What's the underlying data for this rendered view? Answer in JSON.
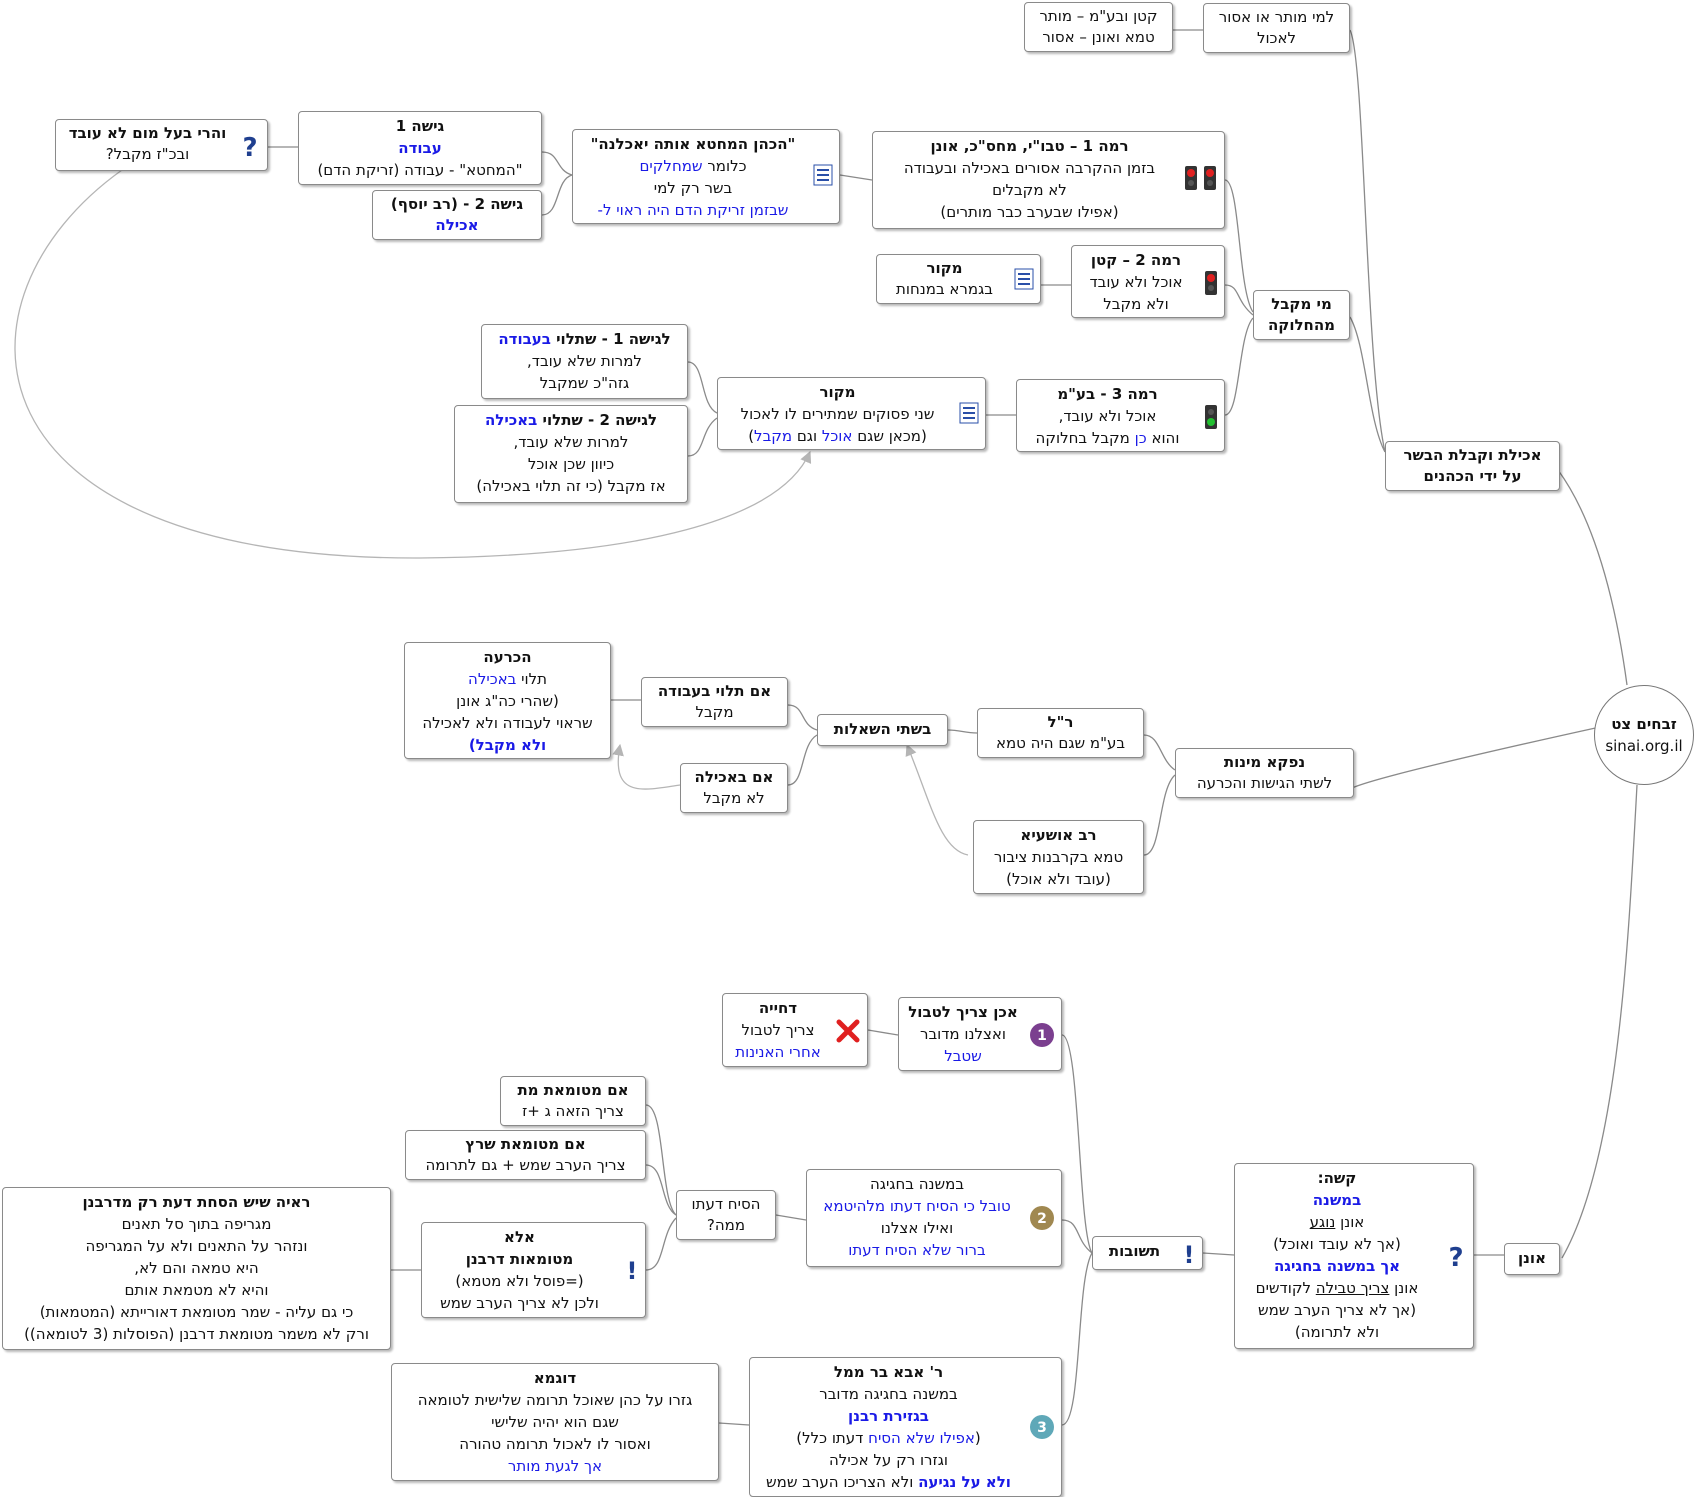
{
  "root": {
    "title": "זבחים צט",
    "site": "sinai.org.il"
  },
  "top": {
    "branch": {
      "line1": "אכילת וקבלת הבשר",
      "line2": "על  ידי הכהנים"
    },
    "who_allowed": {
      "line1": "למי מותר או אסור",
      "line2": "לאכול"
    },
    "katan_onen": {
      "line1": "קטן ובע\"מ – מותר",
      "line2": "טמא ואונן – אסור"
    },
    "mi_mekabel": {
      "line1": "מי מקבל",
      "line2": "מהחלוקה"
    },
    "rama1": {
      "title": "רמה 1 – טבו\"י, מחס\"כ, אונן",
      "line1": "בזמן ההקרבה אסורים באכילה ובעבודה",
      "line2": "לא מקבלים",
      "line3": "(אפילו שבערב כבר מותרים)"
    },
    "hakohen": {
      "title": "\"הכהן המחטא אותה יאכלנה\"",
      "line1a": "כלומר ",
      "line1b": "שמחלקים",
      "line2": "בשר רק למי",
      "line3a": "שבזמן זריקת הדם היה ראוי ל-",
      "line3b": "-"
    },
    "gisha1": {
      "title": "גישה 1",
      "line1": "עבודה",
      "line2": "\"המחטא\" - עבודה (זריקת הדם)"
    },
    "gisha2": {
      "title": "גישה 2  -  (רב יוסף)",
      "line1": "אכילה"
    },
    "baal_mum": {
      "title": "והרי בעל מום לא עובד",
      "line1": "ובכ\"ז מקבל?"
    },
    "rama2": {
      "title": "רמה 2 – קטן",
      "line1": "אוכל ולא עובד",
      "line2": "ולא מקבל"
    },
    "makor_rama2": {
      "title": "מקור",
      "line1": "בגמרא במנחות"
    },
    "rama3": {
      "title": "רמה 3 - בע\"מ",
      "line1": "אוכל ולא עובד,",
      "line2a": "והוא ",
      "line2b": "כן",
      "line2c": " מקבל בחלוקה"
    },
    "makor_rama3": {
      "title": "מקור",
      "line1": "שני פסוקים שמתירים לו לאכול",
      "line2a": "(מכאן שגם ",
      "line2b": "אוכל",
      "line2c": " וגם ",
      "line2d": "מקבל",
      "line2e": ")"
    },
    "lagisha1": {
      "title": "לגישה 1 - שתלוי ",
      "title_blue": "בעבודה",
      "line1": "למרות שלא עובד,",
      "line2": "גזה\"כ שמקבל"
    },
    "lagisha2": {
      "title": "לגישה 2  - שתלוי ",
      "title_blue": "באכילה",
      "line1": "למרות שלא עובד,",
      "line2": "כיוון שכן אוכל",
      "line3": "אז מקבל (כי זה תלוי באכילה)"
    }
  },
  "middle": {
    "nafka": {
      "title": "נפקא מינות",
      "line1": "לשתי הגישות והכרעה"
    },
    "rl": {
      "title": "ר\"ל",
      "line1": "בע\"מ שגם היה טמא"
    },
    "rav_oshaya": {
      "title": "רב אושעיא",
      "line1": "טמא בקרבנות ציבור",
      "line2": "(עובד ולא אוכל)"
    },
    "bishtei": {
      "title": "בשתי השאלות"
    },
    "im_avoda": {
      "title": "אם תלוי בעבודה",
      "line1": "מקבל"
    },
    "im_achila": {
      "title": "אם באכילה",
      "line1": "לא מקבל"
    },
    "hachraa": {
      "title": "הכרעה",
      "line1a": "תלוי ",
      "line1b": "באכילה",
      "line2": "(שהרי כה\"ג אונן",
      "line3": "שראוי לעבודה ולא לאכילה",
      "line4": "ולא מקבל)"
    }
  },
  "bottom": {
    "onen": {
      "title": "אונן"
    },
    "kasha": {
      "title": "קשה:",
      "line1": "במשנה",
      "line2a": "אונן ",
      "line2b": "נוגע",
      "line3": "(אך לא עובד ואוכל)",
      "line4": "אך במשנה בחגיגה",
      "line5a": "אונן ",
      "line5b": "צריך טבילה",
      "line5c": "  לקודשים",
      "line6": "(אך לא צריך הערב שמש",
      "line7": "ולא לתרומה)"
    },
    "teshuvot": {
      "title": "תשובות"
    },
    "ans1": {
      "title": "אכן צריך לטבול",
      "line1": "ואצלנו מדובר",
      "line2": "שטבל"
    },
    "dchiya": {
      "title": "דחייה",
      "line1": "צריך לטבול",
      "line2": "אחרי האנינות"
    },
    "ans2": {
      "line1": "במשנה בחגיגה",
      "line2": "טובל כי הסיח דעתו מלהיטמא",
      "line3": "ואילו אצלנו",
      "line4": "ברור שלא הסיח דעתו"
    },
    "hesiach": {
      "line1": "הסיח דעתו",
      "line2": "ממה?"
    },
    "met": {
      "title": "אם מטומאת מת",
      "line1": "צריך הזאה ג +ז"
    },
    "sheretz": {
      "title": "אם מטומאת שרץ",
      "line1": "צריך הערב שמש + גם לתרומה"
    },
    "ela": {
      "title": "אלא",
      "title2": "מטומאות דרבנן",
      "line1": "(=פוסל ולא מטמא)",
      "line2": "ולכן לא צריך הערב שמש"
    },
    "raaya": {
      "title": "ראיה שיש הסחת דעת רק מדרבנן",
      "line1": "מגריפה בתוך סל תאנים",
      "line2": "ונזהר על התאנים ולא על המגריפה",
      "line3": "היא טמאה והם לא,",
      "line4": "והיא לא מטמאת אותם",
      "line5": "כי גם עליה - שמר מטומאת דאורייתא (המטמאות)",
      "line6": "ורק לא משמר מטומאת דרבנן (הפוסלות (3 לטומאה))"
    },
    "ans3": {
      "title": "ר' אבא בר ממל",
      "line1": "במשנה בחגיגה מדובר",
      "line2": "בגזירת רבנן",
      "line3a": "(",
      "line3b": "אפילו שלא הסיח",
      "line3c": " דעתו כלל)",
      "line4": "וגזרו רק על אכילה",
      "line5a": "ולא על נגיעה",
      "line5b": "   ולא הצריכו הערב שמש"
    },
    "dugma": {
      "title": "דוגמא",
      "line1": "גזרו על כהן שאוכל תרומה שלישית לטומאה",
      "line2": "שגם הוא יהיה שלישי",
      "line3": "ואסור לו לאכול תרומה טהורה",
      "line4": "אך לגעת מותר"
    }
  },
  "icons": {
    "question": "question-mark-icon",
    "exclamation": "exclamation-mark-icon",
    "note": "note-list-icon",
    "traffic_red": "traffic-light-red-icon",
    "traffic_green": "traffic-light-green-icon",
    "cross": "red-x-icon",
    "priority": "numbered-priority-icon"
  },
  "colors": {
    "accent_blue": "#1a1ae6",
    "line_gray": "#8a8a8a",
    "arrow_gray": "#aaaaaa"
  }
}
